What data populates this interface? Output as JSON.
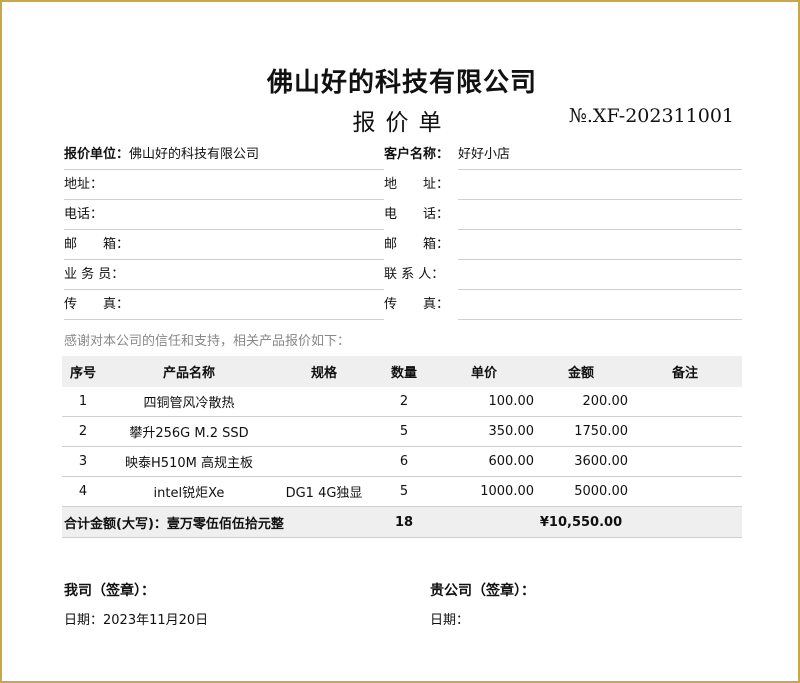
{
  "header": {
    "company": "佛山好的科技有限公司",
    "doc_title": "报价单",
    "doc_no": "№.XF-202311001"
  },
  "info": {
    "rows": [
      {
        "left_label": "报价单位：",
        "left_value": "佛山好的科技有限公司",
        "right_label": "客户名称：",
        "right_value": "好好小店"
      },
      {
        "left_label": "地址：",
        "left_value": "",
        "right_label": "地　　址：",
        "right_value": ""
      },
      {
        "left_label": "电话：",
        "left_value": "",
        "right_label": "电　　话：",
        "right_value": ""
      },
      {
        "left_label": "邮　　箱：",
        "left_value": "",
        "right_label": "邮　　箱：",
        "right_value": ""
      },
      {
        "left_label": "业 务 员：",
        "left_value": "",
        "right_label": "联 系 人：",
        "right_value": ""
      },
      {
        "left_label": "传　　真：",
        "left_value": "",
        "right_label": "传　　真：",
        "right_value": ""
      }
    ]
  },
  "intro_text": "感谢对本公司的信任和支持，相关产品报价如下：",
  "table": {
    "headers": [
      "序号",
      "产品名称",
      "规格",
      "数量",
      "单价",
      "金额",
      "备注"
    ],
    "rows": [
      {
        "no": "1",
        "name": "四铜管风冷散热",
        "spec": "",
        "qty": "2",
        "price": "100.00",
        "amount": "200.00",
        "note": ""
      },
      {
        "no": "2",
        "name": "攀升256G M.2 SSD",
        "spec": "",
        "qty": "5",
        "price": "350.00",
        "amount": "1750.00",
        "note": ""
      },
      {
        "no": "3",
        "name": "映泰H510M 高规主板",
        "spec": "",
        "qty": "6",
        "price": "600.00",
        "amount": "3600.00",
        "note": ""
      },
      {
        "no": "4",
        "name": "intel锐炬Xe",
        "spec": "DG1 4G独显",
        "qty": "5",
        "price": "1000.00",
        "amount": "5000.00",
        "note": ""
      }
    ],
    "total": {
      "label": "合计金额(大写)：壹万零伍佰伍拾元整",
      "qty": "18",
      "amount": "¥10,550.00"
    }
  },
  "signatures": {
    "our_label": "我司（签章）：",
    "our_date": "日期：2023年11月20日",
    "their_label": "贵公司（签章）：",
    "their_date": "日期："
  }
}
